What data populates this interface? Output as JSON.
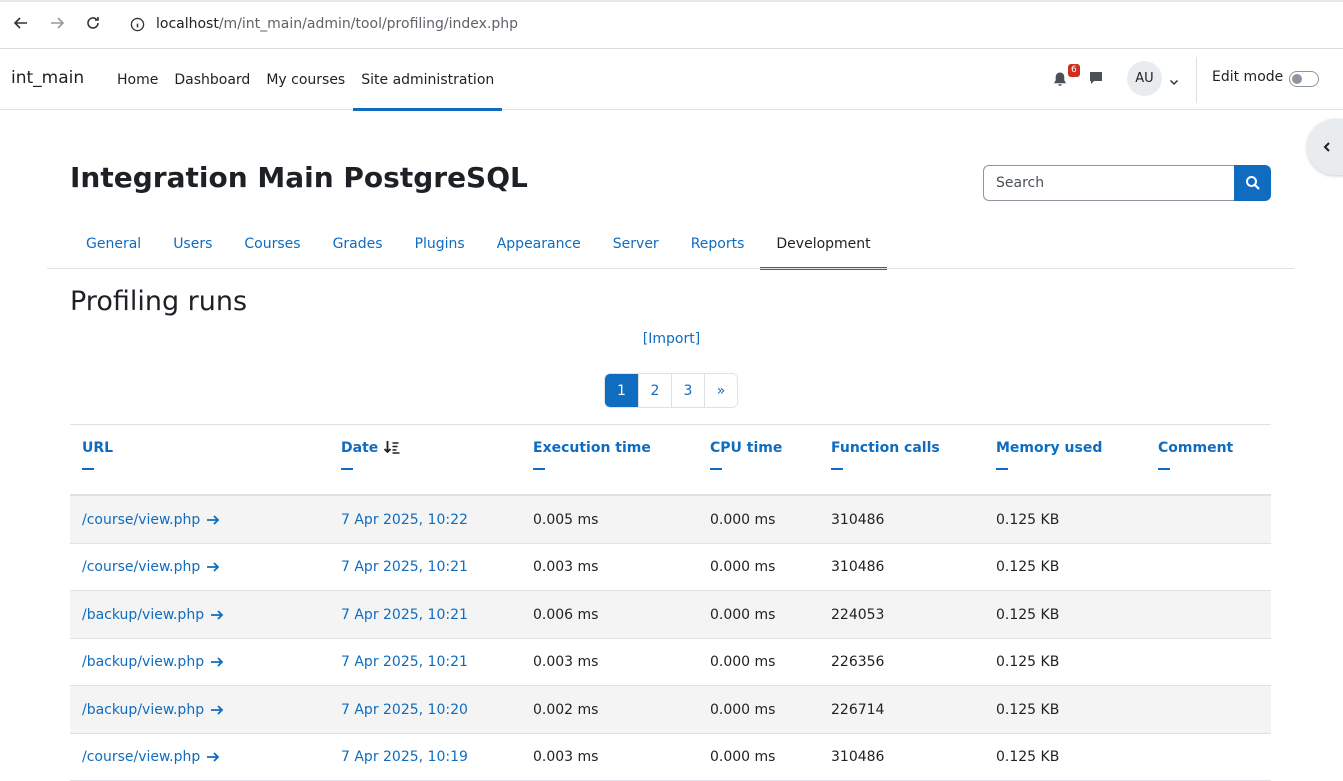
{
  "browser": {
    "url_host": "localhost",
    "url_path": "/m/int_main/admin/tool/profiling/index.php"
  },
  "navbar": {
    "brand": "int_main",
    "items": [
      {
        "label": "Home",
        "active": false
      },
      {
        "label": "Dashboard",
        "active": false
      },
      {
        "label": "My courses",
        "active": false
      },
      {
        "label": "Site administration",
        "active": true
      }
    ],
    "notification_count": "6",
    "avatar_initials": "AU",
    "edit_mode_label": "Edit mode"
  },
  "header": {
    "title": "Integration Main PostgreSQL",
    "search_placeholder": "Search"
  },
  "secondary_nav": [
    {
      "label": "General",
      "active": false
    },
    {
      "label": "Users",
      "active": false
    },
    {
      "label": "Courses",
      "active": false
    },
    {
      "label": "Grades",
      "active": false
    },
    {
      "label": "Plugins",
      "active": false
    },
    {
      "label": "Appearance",
      "active": false
    },
    {
      "label": "Server",
      "active": false
    },
    {
      "label": "Reports",
      "active": false
    },
    {
      "label": "Development",
      "active": true
    }
  ],
  "main": {
    "title": "Profiling runs",
    "import_label": "[Import]",
    "pagination": [
      "1",
      "2",
      "3",
      "»"
    ],
    "current_page": "1",
    "columns": [
      "URL",
      "Date",
      "Execution time",
      "CPU time",
      "Function calls",
      "Memory used",
      "Comment"
    ],
    "rows": [
      {
        "url": "/course/view.php",
        "date": "7 Apr 2025, 10:22",
        "exec": "0.005 ms",
        "cpu": "0.000 ms",
        "calls": "310486",
        "mem": "0.125 KB",
        "comment": ""
      },
      {
        "url": "/course/view.php",
        "date": "7 Apr 2025, 10:21",
        "exec": "0.003 ms",
        "cpu": "0.000 ms",
        "calls": "310486",
        "mem": "0.125 KB",
        "comment": ""
      },
      {
        "url": "/backup/view.php",
        "date": "7 Apr 2025, 10:21",
        "exec": "0.006 ms",
        "cpu": "0.000 ms",
        "calls": "224053",
        "mem": "0.125 KB",
        "comment": ""
      },
      {
        "url": "/backup/view.php",
        "date": "7 Apr 2025, 10:21",
        "exec": "0.003 ms",
        "cpu": "0.000 ms",
        "calls": "226356",
        "mem": "0.125 KB",
        "comment": ""
      },
      {
        "url": "/backup/view.php",
        "date": "7 Apr 2025, 10:20",
        "exec": "0.002 ms",
        "cpu": "0.000 ms",
        "calls": "226714",
        "mem": "0.125 KB",
        "comment": ""
      },
      {
        "url": "/course/view.php",
        "date": "7 Apr 2025, 10:19",
        "exec": "0.003 ms",
        "cpu": "0.000 ms",
        "calls": "310486",
        "mem": "0.125 KB",
        "comment": ""
      }
    ]
  },
  "colors": {
    "accent": "#0f6cbf",
    "badge": "#ca3120"
  }
}
